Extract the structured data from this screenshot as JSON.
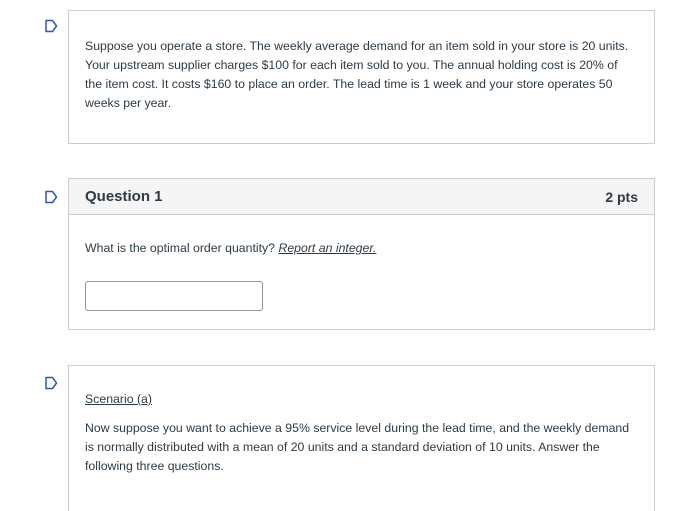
{
  "intro": {
    "text": "Suppose you operate a store. The weekly average demand for an item sold in your store is 20 units. Your upstream supplier charges $100 for each item sold to you. The annual holding cost is 20% of the item cost. It costs $160 to place an order. The lead time is 1 week and your store operates 50 weeks per year."
  },
  "question1": {
    "title": "Question 1",
    "points": "2 pts",
    "prompt": "What is the optimal order quantity? ",
    "emphasis": "Report an integer.",
    "answer_value": ""
  },
  "scenario": {
    "title": "Scenario (a)",
    "text": "Now suppose you want to achieve a 95% service level during the lead time, and the weekly demand is normally distributed with a mean of 20 units and a standard deviation of 10 units. Answer the following three questions."
  },
  "icons": {
    "flag": "bookmark-flag-icon"
  },
  "colors": {
    "text": "#2d3b45",
    "border": "#c7cdd1",
    "header_bg": "#f5f5f5",
    "flag_stroke": "#2d5aa0"
  }
}
